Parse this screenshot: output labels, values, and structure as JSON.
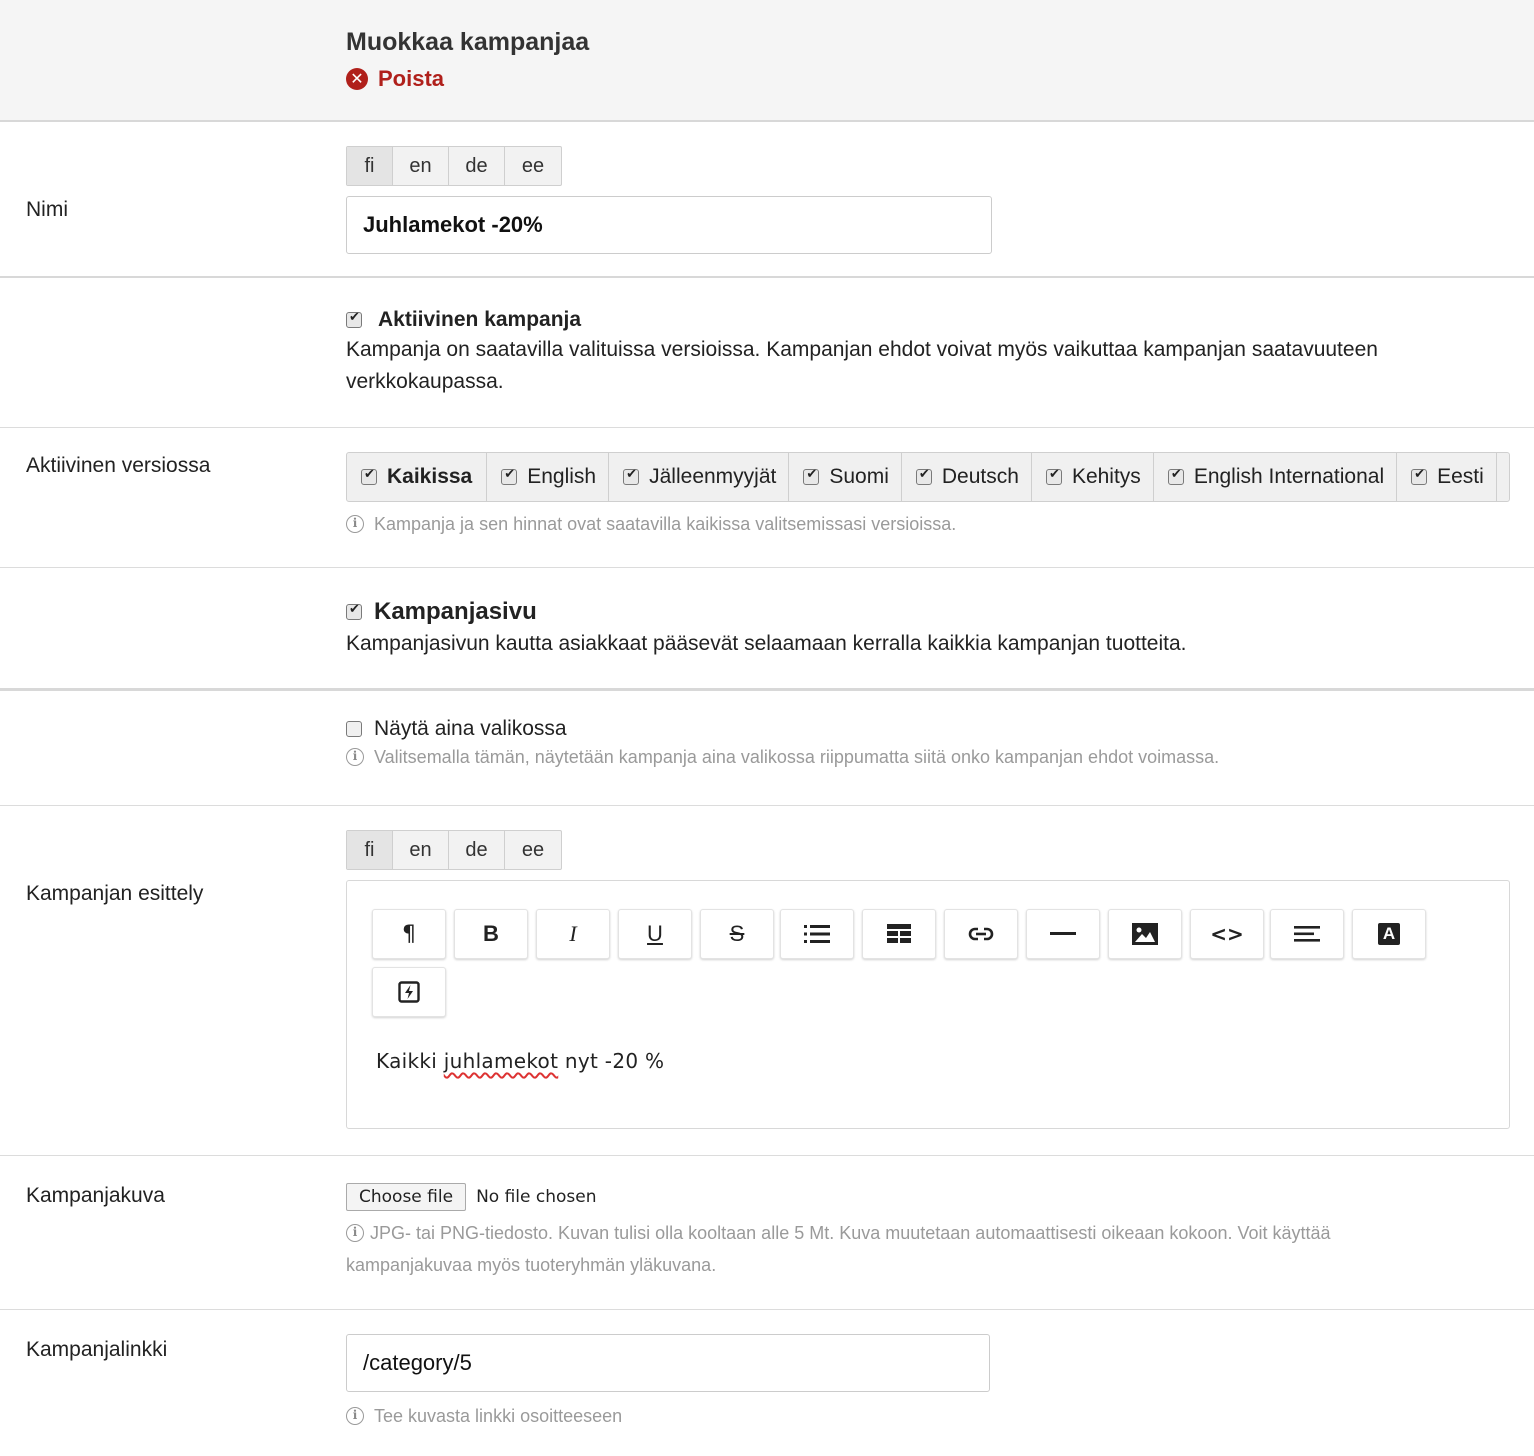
{
  "header": {
    "title": "Muokkaa kampanjaa",
    "delete_label": "Poista",
    "delete_icon": "close-circle-icon"
  },
  "languages": [
    "fi",
    "en",
    "de",
    "ee"
  ],
  "name_section": {
    "label": "Nimi",
    "value": "Juhlamekot -20%"
  },
  "active_campaign": {
    "checked": true,
    "label": "Aktiivinen kampanja",
    "description": "Kampanja on saatavilla valituissa versioissa. Kampanjan ehdot voivat myös vaikuttaa kampanjan saatavuuteen verkkokaupassa."
  },
  "versions_section": {
    "label": "Aktiivinen versiossa",
    "options": [
      {
        "label": "Kaikissa",
        "checked": true
      },
      {
        "label": "English",
        "checked": true
      },
      {
        "label": "Jälleenmyyjät",
        "checked": true
      },
      {
        "label": "Suomi",
        "checked": true
      },
      {
        "label": "Deutsch",
        "checked": true
      },
      {
        "label": "Kehitys",
        "checked": true
      },
      {
        "label": "English International",
        "checked": true
      },
      {
        "label": "Eesti",
        "checked": true
      }
    ],
    "hint": "Kampanja ja sen hinnat ovat saatavilla kaikissa valitsemissasi versioissa."
  },
  "campaign_page": {
    "checked": true,
    "label": "Kampanjasivu",
    "description": "Kampanjasivun kautta asiakkaat pääsevät selaamaan kerralla kaikkia kampanjan tuotteita."
  },
  "show_in_menu": {
    "checked": false,
    "label": "Näytä aina valikossa",
    "hint": "Valitsemalla tämän, näytetään kampanja aina valikossa riippumatta siitä onko kampanjan ehdot voimassa."
  },
  "intro_section": {
    "label": "Kampanjan esittely",
    "toolbar": [
      {
        "name": "paragraph-format-button",
        "icon": "paragraph-icon",
        "glyph": "¶"
      },
      {
        "name": "bold-button",
        "icon": "bold-icon",
        "glyph": "B"
      },
      {
        "name": "italic-button",
        "icon": "italic-icon",
        "glyph": "I"
      },
      {
        "name": "underline-button",
        "icon": "underline-icon",
        "glyph": "U"
      },
      {
        "name": "strikethrough-button",
        "icon": "strikethrough-icon",
        "glyph": "S"
      },
      {
        "name": "bulleted-list-button",
        "icon": "list-icon",
        "glyph": ""
      },
      {
        "name": "table-button",
        "icon": "table-icon",
        "glyph": ""
      },
      {
        "name": "link-button",
        "icon": "link-icon",
        "glyph": ""
      },
      {
        "name": "horizontal-rule-button",
        "icon": "horizontal-rule-icon",
        "glyph": ""
      },
      {
        "name": "image-button",
        "icon": "image-icon",
        "glyph": ""
      },
      {
        "name": "code-button",
        "icon": "code-icon",
        "glyph": "<>"
      },
      {
        "name": "align-button",
        "icon": "align-left-icon",
        "glyph": ""
      },
      {
        "name": "text-color-button",
        "icon": "font-color-icon",
        "glyph": "A"
      },
      {
        "name": "clear-format-button",
        "icon": "flash-icon",
        "glyph": ""
      }
    ],
    "content_before": "Kaikki ",
    "content_misspelled": "juhlamekot",
    "content_after": " nyt -20 %"
  },
  "image_section": {
    "label": "Kampanjakuva",
    "choose_file_label": "Choose file",
    "file_status": "No file chosen",
    "hint": "JPG- tai PNG-tiedosto. Kuvan tulisi olla kooltaan alle 5 Mt. Kuva muutetaan automaattisesti oikeaan kokoon. Voit käyttää kampanjakuvaa myös tuoteryhmän yläkuvana."
  },
  "link_section": {
    "label": "Kampanjalinkki",
    "value": "/category/5",
    "hint": "Tee kuvasta linkki osoitteeseen"
  },
  "colors": {
    "danger": "#b0201b",
    "header_bg": "#f5f5f5",
    "hint_text": "#9a9a9a"
  }
}
